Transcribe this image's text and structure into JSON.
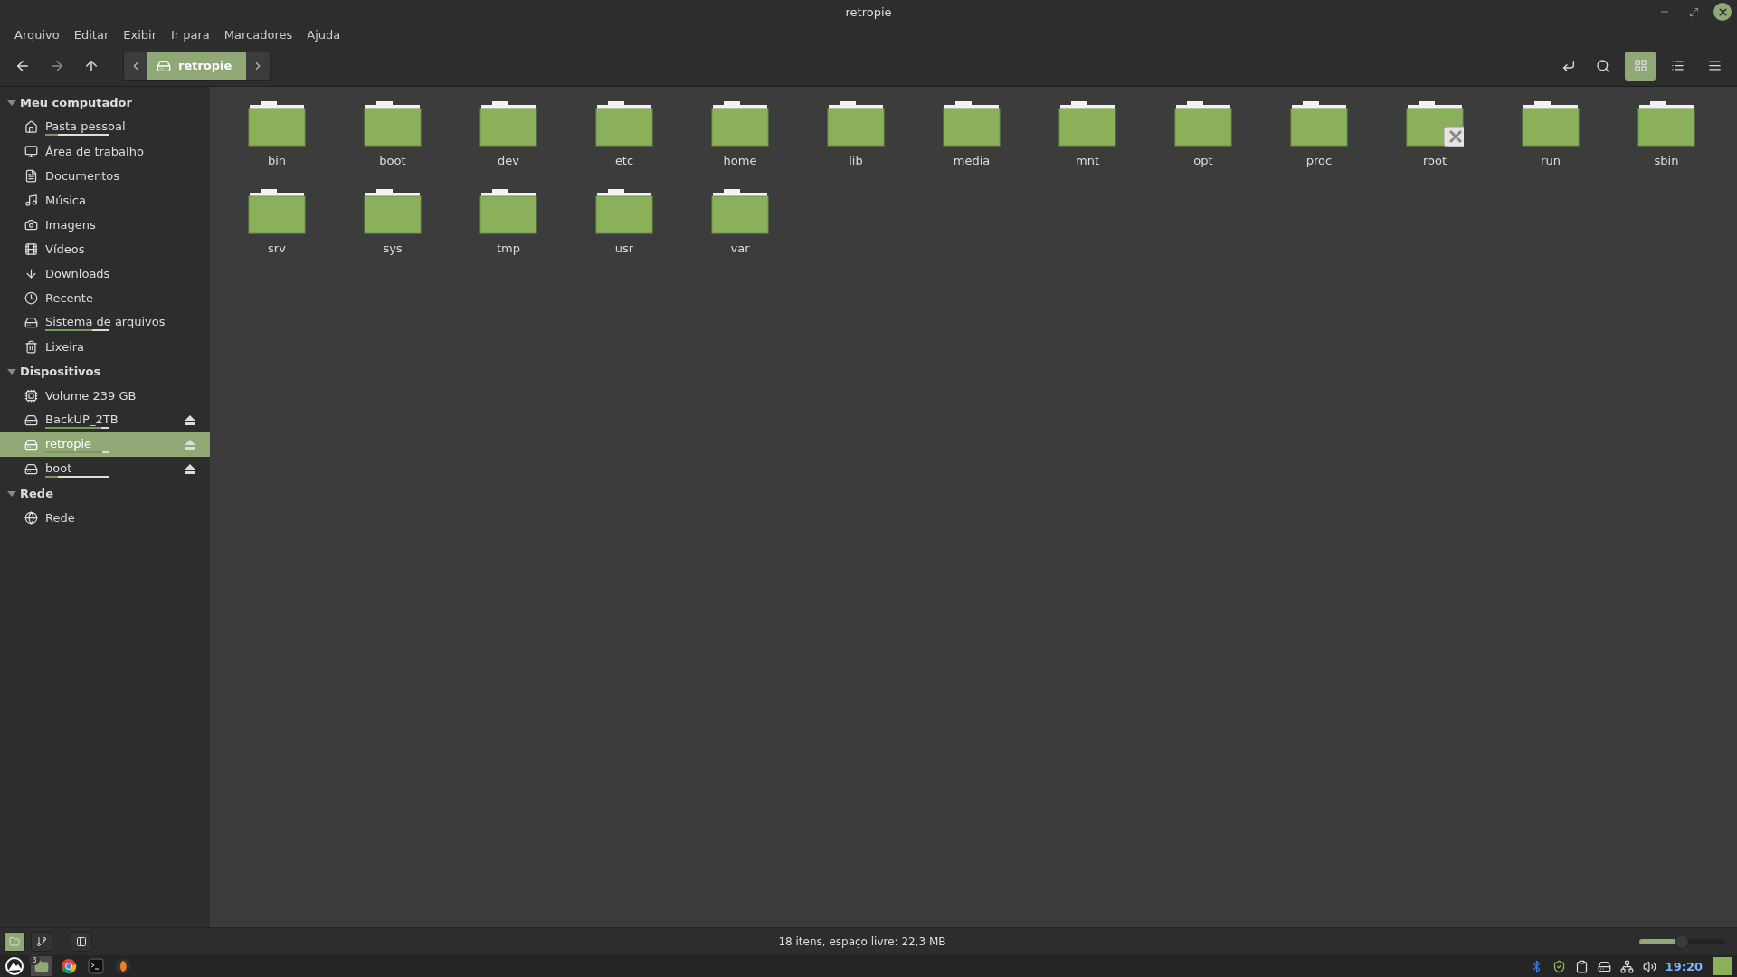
{
  "window": {
    "title": "retropie"
  },
  "menu": [
    "Arquivo",
    "Editar",
    "Exibir",
    "Ir para",
    "Marcadores",
    "Ajuda"
  ],
  "breadcrumb": {
    "label": "retropie"
  },
  "view_buttons": [
    {
      "kind": "icons",
      "selected": true
    },
    {
      "kind": "list",
      "selected": false
    },
    {
      "kind": "compact",
      "selected": false
    }
  ],
  "sidebar": [
    {
      "title": "Meu computador",
      "expanded": true,
      "items": [
        {
          "label": "Pasta pessoal",
          "kind": "home",
          "level": 0.2,
          "selected": false
        },
        {
          "label": "Área de trabalho",
          "kind": "desktop",
          "selected": false
        },
        {
          "label": "Documentos",
          "kind": "document",
          "selected": false
        },
        {
          "label": "Música",
          "kind": "music",
          "selected": false
        },
        {
          "label": "Imagens",
          "kind": "camera",
          "selected": false
        },
        {
          "label": "Vídeos",
          "kind": "film",
          "selected": false
        },
        {
          "label": "Downloads",
          "kind": "download",
          "selected": false
        },
        {
          "label": "Recente",
          "kind": "clock",
          "selected": false
        },
        {
          "label": "Sistema de arquivos",
          "kind": "disk",
          "level": 0.74,
          "selected": false
        },
        {
          "label": "Lixeira",
          "kind": "trash",
          "selected": false
        }
      ]
    },
    {
      "title": "Dispositivos",
      "expanded": true,
      "items": [
        {
          "label": "Volume 239 GB",
          "kind": "chip",
          "selected": false
        },
        {
          "label": "BackUP_2TB",
          "kind": "disk",
          "level": 0.88,
          "eject": true,
          "selected": false
        },
        {
          "label": "retropie",
          "kind": "drive",
          "level": 0.9,
          "eject": true,
          "selected": true
        },
        {
          "label": "boot",
          "kind": "drive",
          "level": 0.2,
          "eject": true,
          "selected": false
        }
      ]
    },
    {
      "title": "Rede",
      "expanded": true,
      "items": [
        {
          "label": "Rede",
          "kind": "globe",
          "selected": false
        }
      ]
    }
  ],
  "files": [
    {
      "name": "bin"
    },
    {
      "name": "boot"
    },
    {
      "name": "dev"
    },
    {
      "name": "etc"
    },
    {
      "name": "home"
    },
    {
      "name": "lib"
    },
    {
      "name": "media"
    },
    {
      "name": "mnt"
    },
    {
      "name": "opt"
    },
    {
      "name": "proc"
    },
    {
      "name": "root",
      "locked": true
    },
    {
      "name": "run"
    },
    {
      "name": "sbin"
    },
    {
      "name": "srv"
    },
    {
      "name": "sys"
    },
    {
      "name": "tmp"
    },
    {
      "name": "usr"
    },
    {
      "name": "var"
    }
  ],
  "status_bar": {
    "text": "18 itens, espaço livre: 22,3 MB",
    "panes": [
      {
        "kind": "places",
        "selected": true
      },
      {
        "kind": "tree",
        "selected": false
      }
    ],
    "zoom": {
      "level": 0.5
    }
  },
  "taskbar": {
    "files_badge": "3",
    "clock": "19:20"
  }
}
